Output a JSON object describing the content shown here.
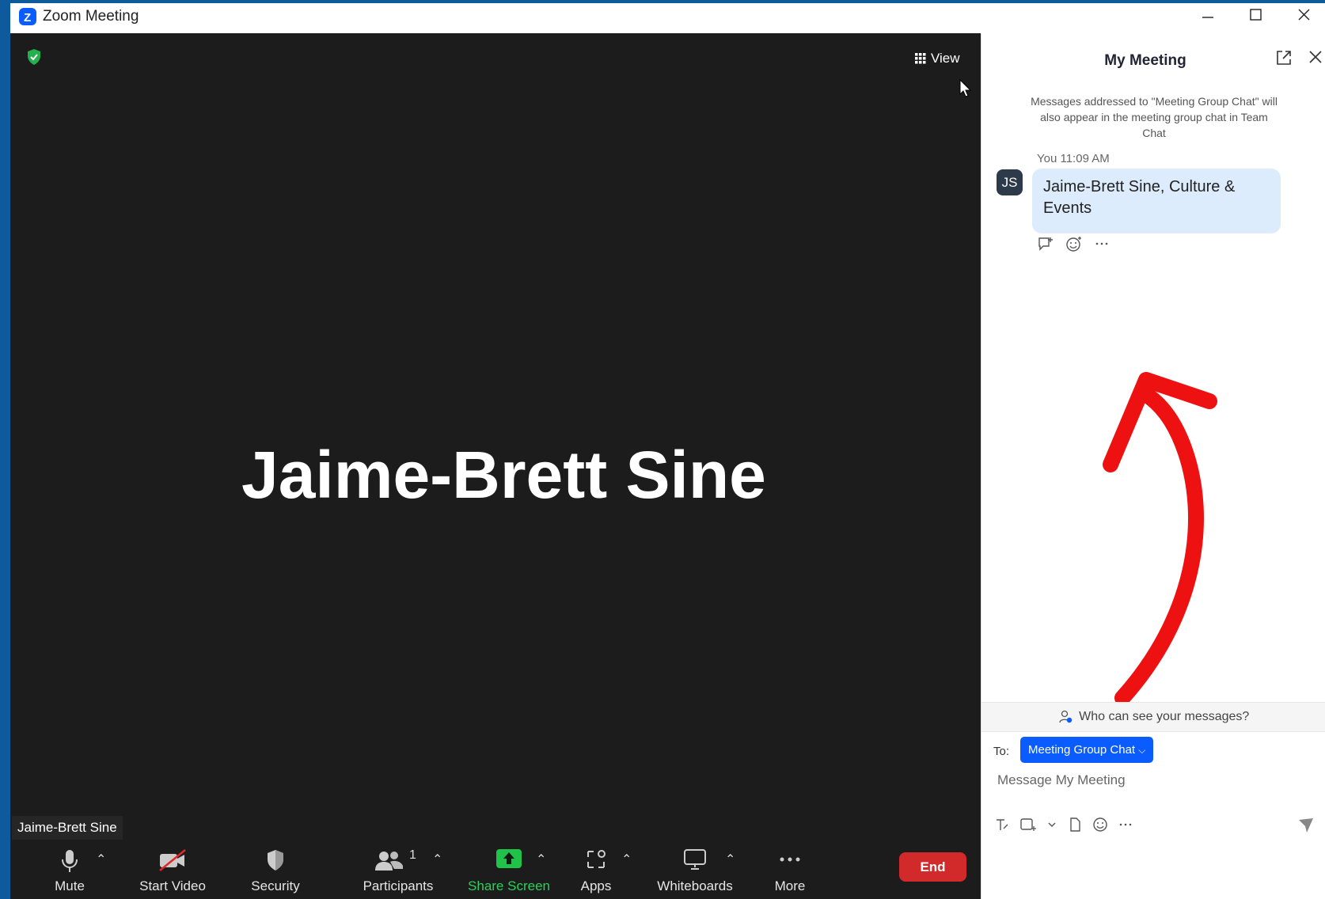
{
  "window": {
    "title": "Zoom Meeting",
    "app_icon": "zoom-logo-icon",
    "controls": [
      "minimize-icon",
      "maximize-icon",
      "close-icon"
    ]
  },
  "meeting": {
    "security_icon": "shield-check-icon",
    "view_label": "View",
    "view_icon": "grid-icon",
    "participant_display_name": "Jaime-Brett Sine",
    "name_tag": "Jaime-Brett Sine"
  },
  "toolbar": {
    "items": [
      {
        "label": "Mute",
        "icon": "microphone-icon",
        "has_caret": true
      },
      {
        "label": "Start Video",
        "icon": "video-off-icon",
        "has_caret": false
      },
      {
        "label": "Security",
        "icon": "shield-icon",
        "has_caret": false
      },
      {
        "label": "Participants",
        "icon": "participants-icon",
        "has_caret": true,
        "count": "1"
      },
      {
        "label": "Share Screen",
        "icon": "share-screen-icon",
        "has_caret": true
      },
      {
        "label": "Apps",
        "icon": "apps-icon",
        "has_caret": true
      },
      {
        "label": "Whiteboards",
        "icon": "whiteboard-icon",
        "has_caret": true
      },
      {
        "label": "More",
        "icon": "more-icon",
        "has_caret": false
      }
    ],
    "end_label": "End"
  },
  "chat": {
    "title": "My Meeting",
    "notice": "Messages addressed to \"Meeting Group Chat\" will also appear in the meeting group chat in Team Chat",
    "message": {
      "sender": "You",
      "time": "11:09 AM",
      "avatar_initials": "JS",
      "text": "Jaime-Brett Sine, Culture & Events"
    },
    "who_can_see": "Who can see your messages?",
    "to_label": "To:",
    "to_value": "Meeting Group Chat",
    "input_placeholder": "Message My Meeting"
  },
  "colors": {
    "meeting_bg": "#1c1c1c",
    "accent_blue": "#0b5cff",
    "end_red": "#d22a2a",
    "share_green": "#21c24a",
    "bubble": "#dcecfc",
    "annotation_arrow": "#ee1111"
  }
}
